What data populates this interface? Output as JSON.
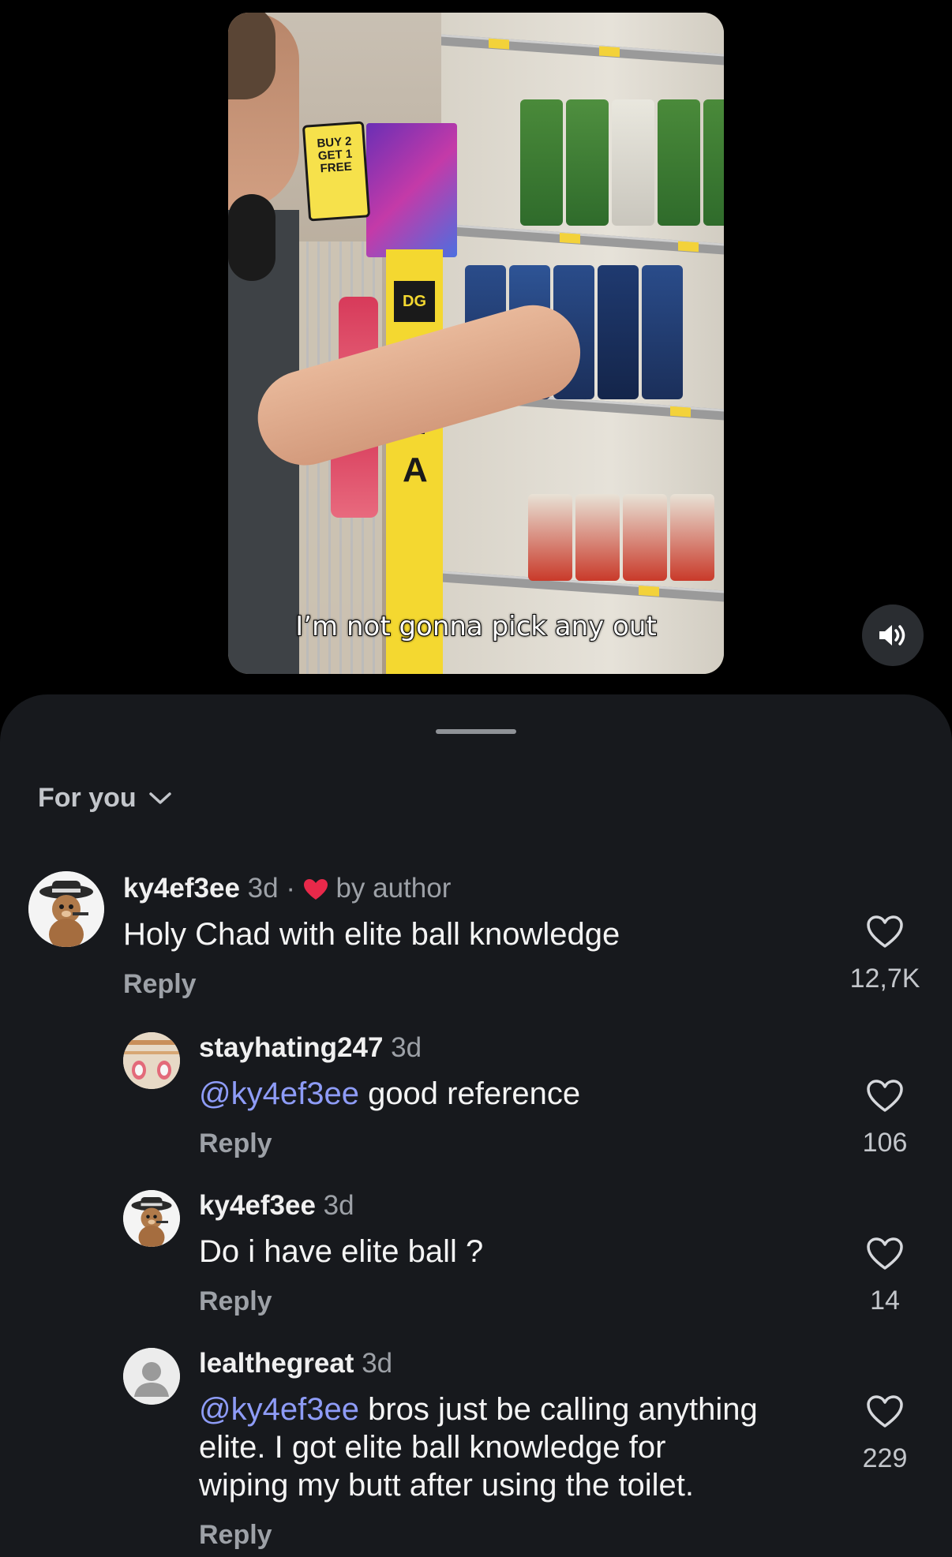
{
  "video": {
    "caption": "I’m not gonna pick any out",
    "promo_sign": "BUY 2 GET 1 FREE",
    "store_logo": "DG",
    "store_sign_letters": "DEA"
  },
  "sound_button": {
    "icon": "speaker-icon"
  },
  "comments_panel": {
    "filter_label": "For you",
    "comments": [
      {
        "username": "ky4ef3ee",
        "time": "3d",
        "separator": "·",
        "liked_by_author": "by author",
        "text": "Holy Chad with elite ball knowledge",
        "reply_label": "Reply",
        "likes": "12,7K"
      },
      {
        "username": "stayhating247",
        "time": "3d",
        "mention": "@ky4ef3ee",
        "text": " good reference",
        "reply_label": "Reply",
        "likes": "106"
      },
      {
        "username": "ky4ef3ee",
        "time": "3d",
        "text": "Do i have elite ball ?",
        "reply_label": "Reply",
        "likes": "14"
      },
      {
        "username": "lealthegreat",
        "time": "3d",
        "mention": "@ky4ef3ee",
        "text_line1": " bros just be calling anything",
        "text_line2": "elite. I got elite ball knowledge for",
        "text_line3": "wiping my butt after using the toilet.",
        "reply_label": "Reply",
        "likes": "229"
      }
    ]
  },
  "colors": {
    "sheet_bg": "#17191d",
    "mention": "#8e9cf7",
    "author_heart": "#e8294a",
    "muted_text": "#9da1a7"
  }
}
